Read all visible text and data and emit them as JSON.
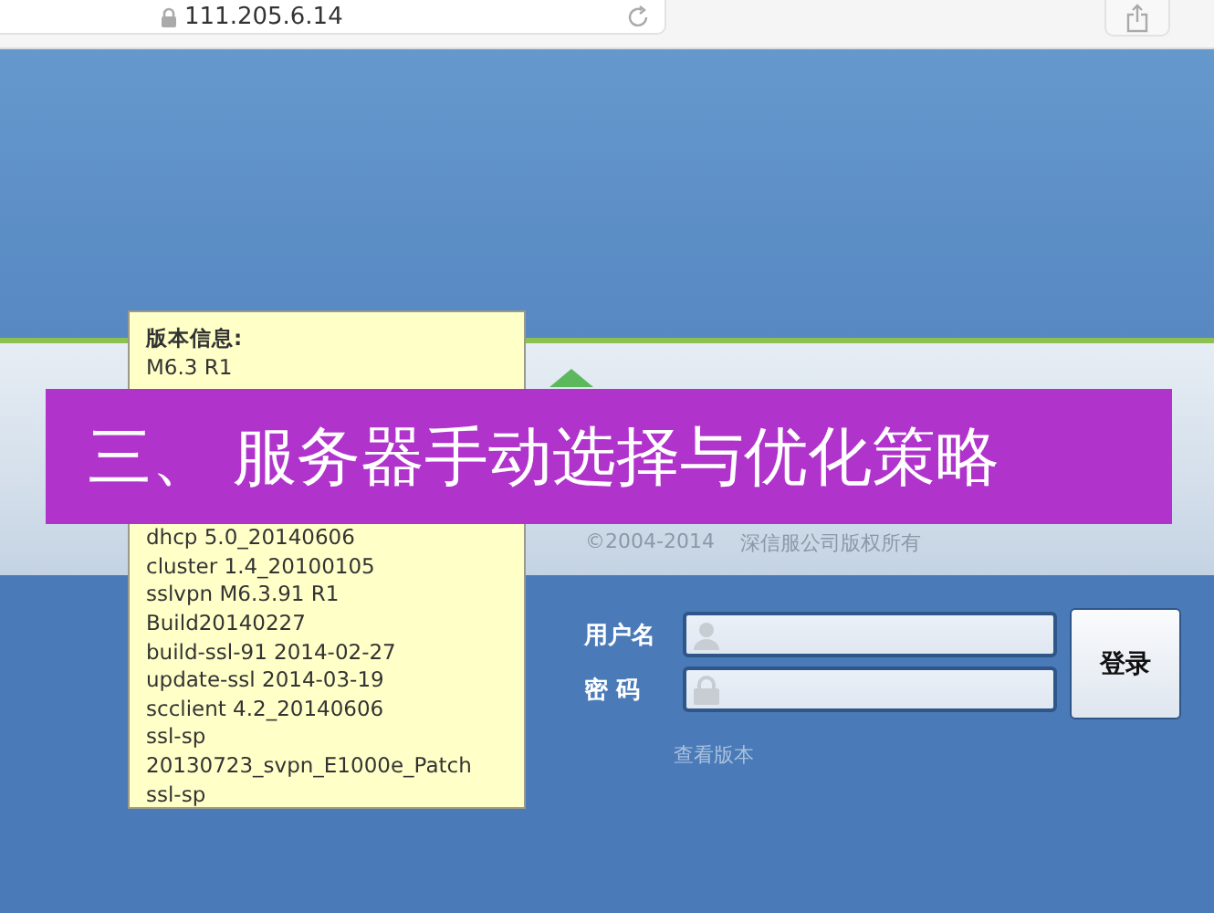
{
  "browser": {
    "address": "111.205.6.14"
  },
  "copyright": {
    "years": "©2004-2014",
    "owner": "深信服公司版权所有"
  },
  "login": {
    "username_label": "用户名",
    "password_label": "密 码",
    "button": "登录",
    "version_link": "查看版本"
  },
  "version_tooltip": {
    "title": "版本信息:",
    "lines_top": [
      "M6.3 R1"
    ],
    "lines_bottom": [
      "dhcp 5.0_20140606",
      "cluster 1.4_20100105",
      "sslvpn M6.3.91 R1",
      "Build20140227",
      "build-ssl-91 2014-02-27",
      "update-ssl 2014-03-19",
      "scclient 4.2_20140606",
      "ssl-sp",
      "20130723_svpn_E1000e_Patch",
      "ssl-sp"
    ]
  },
  "banner": {
    "text": "三、 服务器手动选择与优化策略"
  }
}
